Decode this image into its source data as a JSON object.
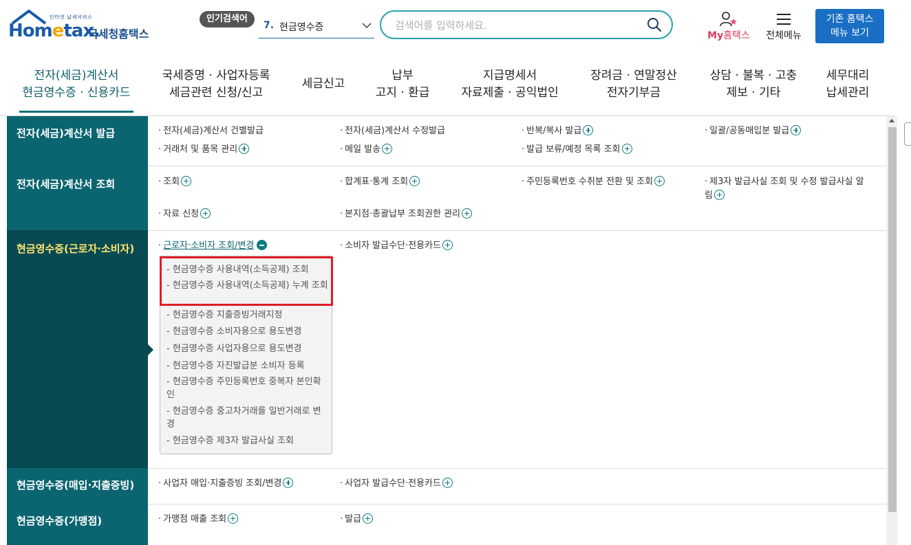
{
  "header": {
    "logo_tagline": "인터넷 납세서비스",
    "logo_word_part1": "Hom",
    "logo_word_e": "e",
    "logo_word_part2": "tax.",
    "logo_sub": "국세청홈택스",
    "popular_badge": "인기검색어",
    "popular_rank": "7.",
    "popular_term": "현금영수증",
    "search_placeholder": "검색어를 입력하세요.",
    "myhome_prefix": "My",
    "myhome_suffix": "홈택스",
    "allmenu_label": "전체메뉴",
    "old_menu_line1": "기존 홈택스",
    "old_menu_line2": "메뉴 보기",
    "colors": {
      "brand": "#1a5aa8",
      "accent": "#0b6570",
      "highlight": "#e21b24",
      "old_button": "#1a6fc4"
    }
  },
  "nav": [
    {
      "line1": "전자(세금)계산서",
      "line2": "현금영수증 · 신용카드",
      "active": true
    },
    {
      "line1": "국세증명 · 사업자등록",
      "line2": "세금관련 신청/신고"
    },
    {
      "line1": "세금신고",
      "line2": ""
    },
    {
      "line1": "납부",
      "line2": "고지 · 환급"
    },
    {
      "line1": "지급명세서",
      "line2": "자료제출 · 공익법인"
    },
    {
      "line1": "장려금 · 연말정산",
      "line2": "전자기부금"
    },
    {
      "line1": "상담 · 불복 · 고충",
      "line2": "제보 · 기타"
    },
    {
      "line1": "세무대리",
      "line2": "납세관리"
    }
  ],
  "sections": [
    {
      "title": "전자(세금)계산서 발급",
      "links": [
        "전자(세금)계산서 건별발급",
        "전자(세금)계산서 수정발급",
        "반복/복사 발급",
        "일괄/공동매입분 발급",
        "거래처 및 품목 관리",
        "메일 발송",
        "발급 보류/예정 목록 조회"
      ]
    },
    {
      "title": "전자(세금)계산서 조회",
      "links": [
        "조회",
        "합계표·통계 조회",
        "주민등록번호 수취분 전환 및 조회",
        "제3자 발급사실 조회 및 수정 발급사실 알림",
        "자료 신청",
        "본지점·총괄납부 조회권한 관리"
      ]
    },
    {
      "title": "현금영수증(근로자·소비자)",
      "links": [
        "근로자·소비자 조회/변경",
        "소비자 발급수단·전용카드"
      ],
      "submenu": [
        "현금영수증 사용내역(소득공제) 조회",
        "현금영수증 사용내역(소득공제) 누계 조회",
        "현금영수증 지출증빙거래지정",
        "현금영수증 소비자용으로 용도변경",
        "현금영수증 사업자용으로 용도변경",
        "현금영수증 자진발급분 소비자 등록",
        "현금영수증 주민등록번호 중복자 본인확인",
        "현금영수증 중고차거래를 일반거래로 변경",
        "현금영수증 제3자 발급사실 조회"
      ]
    },
    {
      "title": "현금영수증(매입·지출증빙)",
      "links": [
        "사업자 매입·지출증빙 조회/변경",
        "사업자 발급수단·전용카드"
      ]
    },
    {
      "title": "현금영수증(가맹점)",
      "links": [
        "가맹점 매출 조회",
        "발급"
      ]
    }
  ]
}
